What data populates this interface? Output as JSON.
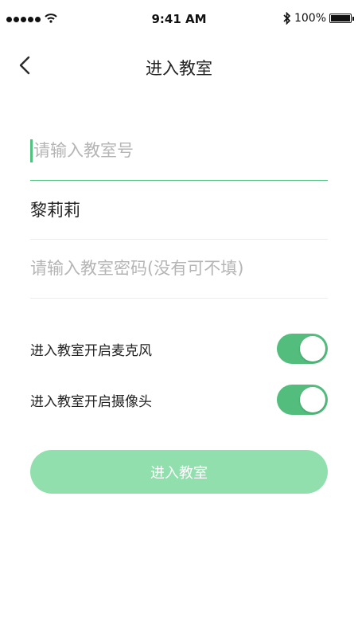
{
  "status_bar": {
    "time": "9:41 AM",
    "battery": "100%"
  },
  "nav": {
    "title": "进入教室"
  },
  "form": {
    "room_number": {
      "value": "",
      "placeholder": "请输入教室号"
    },
    "nickname": {
      "value": "黎莉莉",
      "placeholder": ""
    },
    "password": {
      "value": "",
      "placeholder": "请输入教室密码(没有可不填)"
    }
  },
  "toggles": [
    {
      "label": "进入教室开启麦克风",
      "on": true
    },
    {
      "label": "进入教室开启摄像头",
      "on": true
    }
  ],
  "enter_button": {
    "label": "进入教室"
  },
  "colors": {
    "accent": "#52bd7c",
    "button_disabled": "#92dfae"
  }
}
